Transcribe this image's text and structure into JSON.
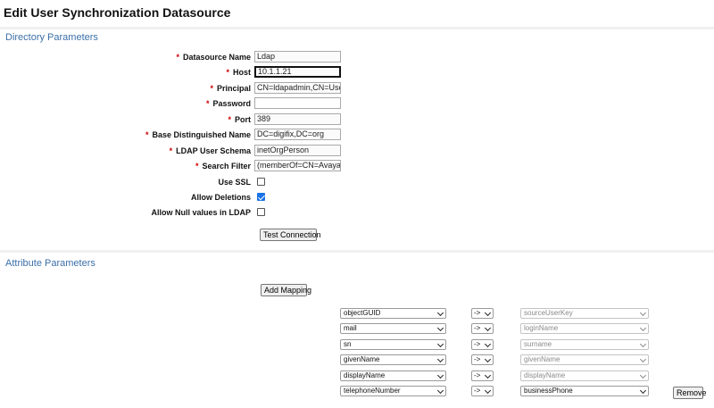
{
  "page": {
    "title": "Edit User Synchronization Datasource"
  },
  "sections": {
    "directory": "Directory Parameters",
    "attribute": "Attribute Parameters"
  },
  "fields": {
    "datasource_name": {
      "label": "Datasource Name",
      "required": true,
      "value": "Ldap"
    },
    "host": {
      "label": "Host",
      "required": true,
      "value": "10.1.1.21"
    },
    "principal": {
      "label": "Principal",
      "required": true,
      "value": "CN=ldapadmin,CN=Users"
    },
    "password": {
      "label": "Password",
      "required": true,
      "value": ""
    },
    "port": {
      "label": "Port",
      "required": true,
      "value": "389"
    },
    "base_dn": {
      "label": "Base Distinguished Name",
      "required": true,
      "value": "DC=digifix,DC=org"
    },
    "ldap_schema": {
      "label": "LDAP User Schema",
      "required": true,
      "value": "inetOrgPerson"
    },
    "search_filter": {
      "label": "Search Filter",
      "required": true,
      "value": "(memberOf=CN=Avaya_"
    },
    "use_ssl": {
      "label": "Use SSL",
      "checked": false
    },
    "allow_deletions": {
      "label": "Allow Deletions",
      "checked": true
    },
    "allow_null": {
      "label": "Allow Null values in LDAP",
      "checked": false
    }
  },
  "required_mark": "*",
  "buttons": {
    "test_connection": "Test Connection",
    "add_mapping": "Add Mapping",
    "remove": "Remove"
  },
  "mappings": [
    {
      "attribute": "objectGUID",
      "arrow": "->",
      "target": "sourceUserKey",
      "editable": false
    },
    {
      "attribute": "mail",
      "arrow": "->",
      "target": "loginName",
      "editable": false
    },
    {
      "attribute": "sn",
      "arrow": "->",
      "target": "surname",
      "editable": false
    },
    {
      "attribute": "givenName",
      "arrow": "->",
      "target": "givenName",
      "editable": false
    },
    {
      "attribute": "displayName",
      "arrow": "->",
      "target": "displayName",
      "editable": false
    },
    {
      "attribute": "telephoneNumber",
      "arrow": "->",
      "target": "businessPhone",
      "editable": true
    }
  ],
  "colors": {
    "section_title": "#3b6fa8",
    "required": "#cc0000",
    "checkbox_checked": "#1a73e8"
  }
}
